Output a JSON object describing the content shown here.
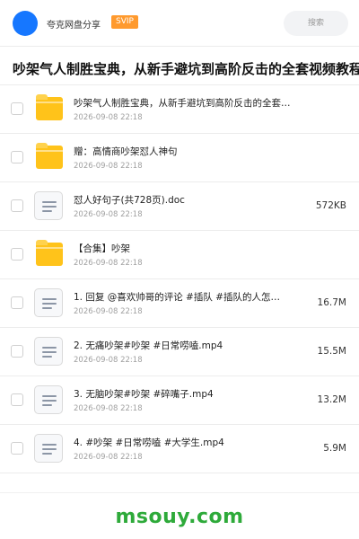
{
  "header": {
    "app_name": "夸克网盘分享",
    "badge": "SVIP",
    "search_label": "搜索"
  },
  "page_title": "吵架气人制胜宝典，从新手避坑到高阶反击的全套视频教程",
  "files": [
    {
      "type": "folder",
      "name": "吵架气人制胜宝典，从新手避坑到高阶反击的全套视频教程",
      "date": "2026-09-08 22:18",
      "size": ""
    },
    {
      "type": "folder",
      "name": "赠：高情商吵架怼人神句",
      "date": "2026-09-08 22:18",
      "size": ""
    },
    {
      "type": "file",
      "name": "怼人好句子(共728页).doc",
      "date": "2026-09-08 22:18",
      "size": "572KB"
    },
    {
      "type": "folder",
      "name": "【合集】吵架",
      "date": "2026-09-08 22:18",
      "size": ""
    },
    {
      "type": "file",
      "name": "1. 回复 @喜欢帅哥的评论 #插队 #插队的人怎…",
      "date": "2026-09-08 22:18",
      "size": "16.7M"
    },
    {
      "type": "file",
      "name": "2. 无痛吵架#吵架 #日常唠嗑.mp4",
      "date": "2026-09-08 22:18",
      "size": "15.5M"
    },
    {
      "type": "file",
      "name": "3. 无脑吵架#吵架 #碎嘴子.mp4",
      "date": "2026-09-08 22:18",
      "size": "13.2M"
    },
    {
      "type": "file",
      "name": "4. #吵架 #日常唠嗑 #大学生.mp4",
      "date": "2026-09-08 22:18",
      "size": "5.9M"
    }
  ],
  "watermark": "msouy.com",
  "colors": {
    "accent": "#1677ff",
    "svip_badge": "#ff9a2e",
    "folder": "#ffc31a",
    "watermark": "#2eaa3a"
  },
  "icons": {
    "folder": "folder-icon",
    "file": "document-icon"
  }
}
